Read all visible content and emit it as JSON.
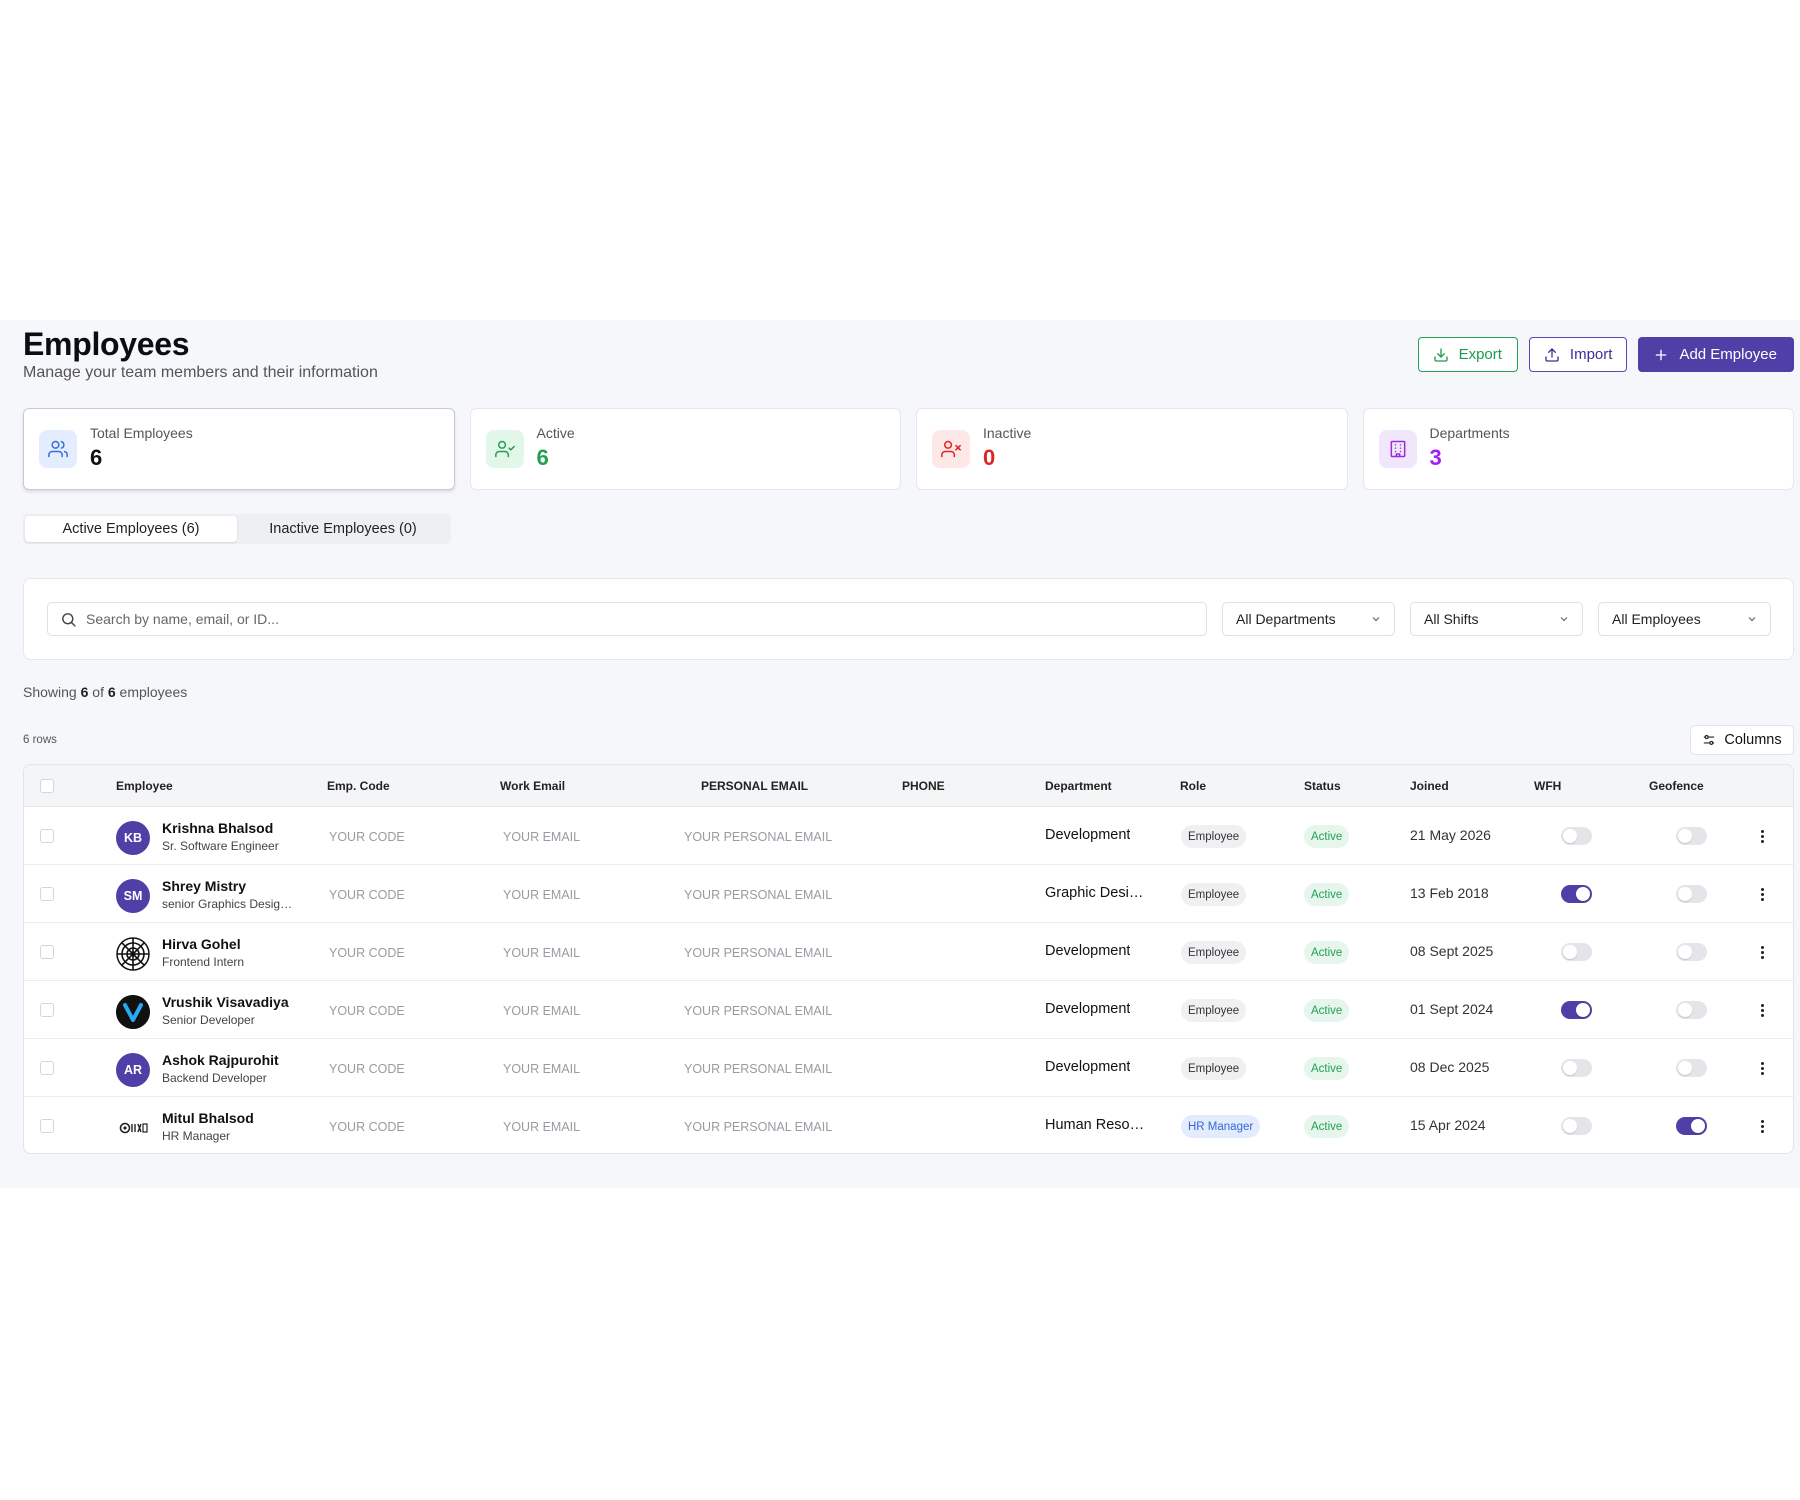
{
  "header": {
    "title": "Employees",
    "subtitle": "Manage your team members and their information",
    "export_label": "Export",
    "import_label": "Import",
    "add_label": "Add Employee"
  },
  "stats": [
    {
      "label": "Total Employees",
      "value": "6",
      "icon": "users-icon",
      "color": "#111111",
      "icon_bg": "#e3edfd",
      "icon_color": "#3b6fd9"
    },
    {
      "label": "Active",
      "value": "6",
      "icon": "user-check-icon",
      "color": "#22a04f",
      "icon_bg": "#e3f6ea",
      "icon_color": "#22a04f"
    },
    {
      "label": "Inactive",
      "value": "0",
      "icon": "user-x-icon",
      "color": "#e02424",
      "icon_bg": "#fde7e7",
      "icon_color": "#e02424"
    },
    {
      "label": "Departments",
      "value": "3",
      "icon": "building-icon",
      "color": "#a020f0",
      "icon_bg": "#f1e7fd",
      "icon_color": "#9b2bdc"
    }
  ],
  "tabs": [
    {
      "label": "Active Employees (6)",
      "active": true
    },
    {
      "label": "Inactive Employees (0)",
      "active": false
    }
  ],
  "filters": {
    "search_placeholder": "Search by name, email, or ID...",
    "department": "All Departments",
    "shift": "All Shifts",
    "employees": "All Employees"
  },
  "summary": {
    "prefix": "Showing",
    "shown": "6",
    "of": "of",
    "total": "6",
    "suffix": "employees",
    "rows": "6 rows",
    "columns_label": "Columns"
  },
  "table": {
    "columns": [
      "Employee",
      "Emp. Code",
      "Work Email",
      "PERSONAL EMAIL",
      "PHONE",
      "Department",
      "Role",
      "Status",
      "Joined",
      "WFH",
      "Geofence"
    ],
    "rows": [
      {
        "initials": "KB",
        "avatar_type": "initials",
        "avatar_color": "#4f3fa6",
        "name": "Krishna Bhalsod",
        "title": "Sr. Software Engineer",
        "code": "YOUR CODE",
        "work_email": "YOUR EMAIL",
        "personal_email": "YOUR PERSONAL EMAIL",
        "department": "Development",
        "role": "Employee",
        "status": "Active",
        "joined": "21 May 2026",
        "wfh": false,
        "geofence": false
      },
      {
        "initials": "SM",
        "avatar_type": "initials",
        "avatar_color": "#4f3fa6",
        "name": "Shrey Mistry",
        "title": "senior Graphics Designer",
        "code": "YOUR CODE",
        "work_email": "YOUR EMAIL",
        "personal_email": "YOUR PERSONAL EMAIL",
        "department": "Graphic Designer",
        "role": "Employee",
        "status": "Active",
        "joined": "13 Feb 2018",
        "wfh": true,
        "geofence": false
      },
      {
        "initials": "",
        "avatar_type": "mandala",
        "avatar_color": "#111111",
        "name": "Hirva Gohel",
        "title": "Frontend Intern",
        "code": "YOUR CODE",
        "work_email": "YOUR EMAIL",
        "personal_email": "YOUR PERSONAL EMAIL",
        "department": "Development",
        "role": "Employee",
        "status": "Active",
        "joined": "08 Sept 2025",
        "wfh": false,
        "geofence": false
      },
      {
        "initials": "",
        "avatar_type": "v-logo",
        "avatar_color": "#111111",
        "name": "Vrushik Visavadiya",
        "title": "Senior Developer",
        "code": "YOUR CODE",
        "work_email": "YOUR EMAIL",
        "personal_email": "YOUR PERSONAL EMAIL",
        "department": "Development",
        "role": "Employee",
        "status": "Active",
        "joined": "01 Sept 2024",
        "wfh": true,
        "geofence": false
      },
      {
        "initials": "AR",
        "avatar_type": "initials",
        "avatar_color": "#4f3fa6",
        "name": "Ashok Rajpurohit",
        "title": "Backend Developer",
        "code": "YOUR CODE",
        "work_email": "YOUR EMAIL",
        "personal_email": "YOUR PERSONAL EMAIL",
        "department": "Development",
        "role": "Employee",
        "status": "Active",
        "joined": "08 Dec 2025",
        "wfh": false,
        "geofence": false
      },
      {
        "initials": "",
        "avatar_type": "logo-mark",
        "avatar_color": "#ffffff",
        "name": "Mitul Bhalsod",
        "title": "HR Manager",
        "code": "YOUR CODE",
        "work_email": "YOUR EMAIL",
        "personal_email": "YOUR PERSONAL EMAIL",
        "department": "Human Resources",
        "role": "HR Manager",
        "status": "Active",
        "joined": "15 Apr 2024",
        "wfh": false,
        "geofence": true
      }
    ]
  },
  "colors": {
    "brand": "#4f3fa6",
    "success": "#22a04f",
    "danger": "#e02424",
    "purple": "#a020f0"
  }
}
